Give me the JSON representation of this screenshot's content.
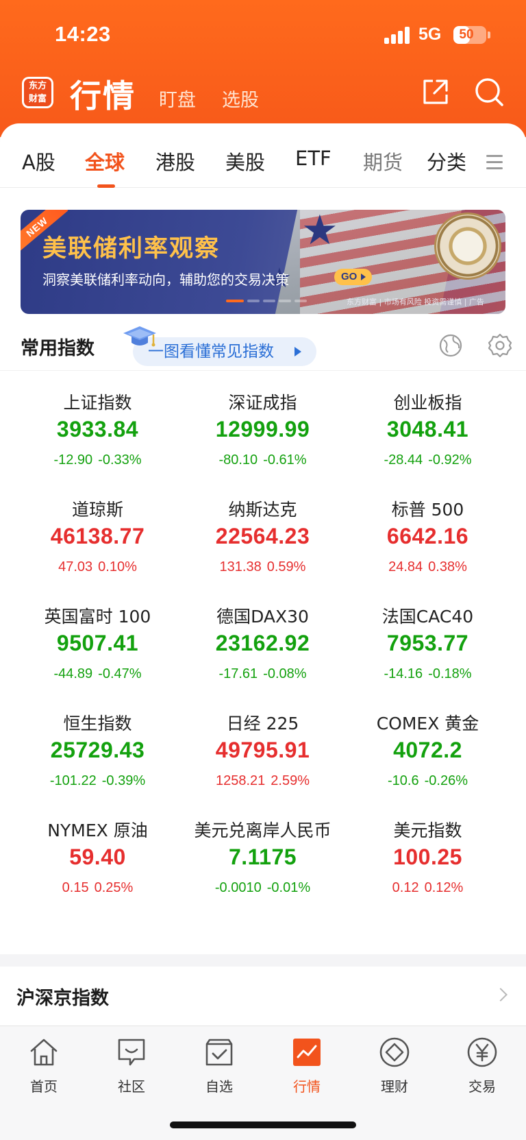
{
  "status_bar": {
    "time": "14:23",
    "network": "5G",
    "battery": "50",
    "battery_level": 0.5
  },
  "header": {
    "logo_text": "东方财富",
    "title": "行情",
    "tabs": [
      "盯盘",
      "选股"
    ]
  },
  "market_tabs": [
    {
      "label": "A股"
    },
    {
      "label": "全球",
      "active": true
    },
    {
      "label": "港股"
    },
    {
      "label": "美股"
    },
    {
      "label": "ETF"
    },
    {
      "label": "期货"
    },
    {
      "label": "分类"
    }
  ],
  "banner": {
    "badge": "NEW",
    "title": "美联储利率观察",
    "subtitle": "洞察美联储利率动向，辅助您的交易决策",
    "go_label": "GO",
    "footer": "东方财富 | 市场有风险 投资需谨慎 | 广告",
    "slides": 5,
    "active_slide": 1
  },
  "common_index": {
    "title": "常用指数",
    "guide_link": "一图看懂常见指数"
  },
  "indices": [
    {
      "name": "上证指数",
      "price": "3933.84",
      "change": "-12.90",
      "pct": "-0.33%",
      "dir": "down"
    },
    {
      "name": "深证成指",
      "price": "12999.99",
      "change": "-80.10",
      "pct": "-0.61%",
      "dir": "down"
    },
    {
      "name": "创业板指",
      "price": "3048.41",
      "change": "-28.44",
      "pct": "-0.92%",
      "dir": "down"
    },
    {
      "name": "道琼斯",
      "price": "46138.77",
      "change": "47.03",
      "pct": "0.10%",
      "dir": "up"
    },
    {
      "name": "纳斯达克",
      "price": "22564.23",
      "change": "131.38",
      "pct": "0.59%",
      "dir": "up"
    },
    {
      "name": "标普 500",
      "price": "6642.16",
      "change": "24.84",
      "pct": "0.38%",
      "dir": "up"
    },
    {
      "name": "英国富时 100",
      "price": "9507.41",
      "change": "-44.89",
      "pct": "-0.47%",
      "dir": "down"
    },
    {
      "name": "德国DAX30",
      "price": "23162.92",
      "change": "-17.61",
      "pct": "-0.08%",
      "dir": "down"
    },
    {
      "name": "法国CAC40",
      "price": "7953.77",
      "change": "-14.16",
      "pct": "-0.18%",
      "dir": "down"
    },
    {
      "name": "恒生指数",
      "price": "25729.43",
      "change": "-101.22",
      "pct": "-0.39%",
      "dir": "down"
    },
    {
      "name": "日经 225",
      "price": "49795.91",
      "change": "1258.21",
      "pct": "2.59%",
      "dir": "up"
    },
    {
      "name": "COMEX 黄金",
      "price": "4072.2",
      "change": "-10.6",
      "pct": "-0.26%",
      "dir": "down"
    },
    {
      "name": "NYMEX 原油",
      "price": "59.40",
      "change": "0.15",
      "pct": "0.25%",
      "dir": "up"
    },
    {
      "name": "美元兑离岸人民币",
      "price": "7.1175",
      "change": "-0.0010",
      "pct": "-0.01%",
      "dir": "down"
    },
    {
      "name": "美元指数",
      "price": "100.25",
      "change": "0.12",
      "pct": "0.12%",
      "dir": "up"
    }
  ],
  "next_section": {
    "label": "沪深京指数"
  },
  "bottom_nav": [
    {
      "label": "首页",
      "icon": "home-icon"
    },
    {
      "label": "社区",
      "icon": "community-icon"
    },
    {
      "label": "自选",
      "icon": "watchlist-icon"
    },
    {
      "label": "行情",
      "icon": "market-icon",
      "active": true
    },
    {
      "label": "理财",
      "icon": "wealth-icon"
    },
    {
      "label": "交易",
      "icon": "trade-icon"
    }
  ],
  "colors": {
    "brand": "#f7591a",
    "up": "#e62e2e",
    "down": "#13a10e",
    "accent_blue": "#2b6fd6"
  }
}
